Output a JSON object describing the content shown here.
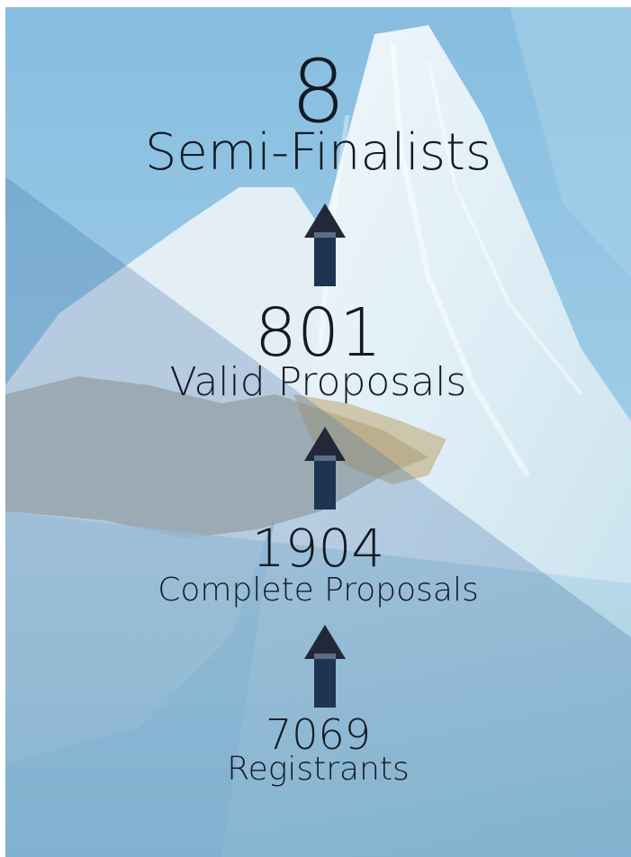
{
  "funnel": {
    "stages": [
      {
        "value": "8",
        "label": "Semi-Finalists"
      },
      {
        "value": "801",
        "label": "Valid Proposals"
      },
      {
        "value": "1904",
        "label": "Complete Proposals"
      },
      {
        "value": "7069",
        "label": "Registrants"
      }
    ],
    "arrow_color": "#1d3550",
    "arrow_head_color": "#232838",
    "text_color": "#141a22"
  },
  "background": {
    "description_icon": "snowy-mountain-image",
    "sky_color": "#8fc3e3",
    "overlay_color": "#3f6fa6"
  }
}
